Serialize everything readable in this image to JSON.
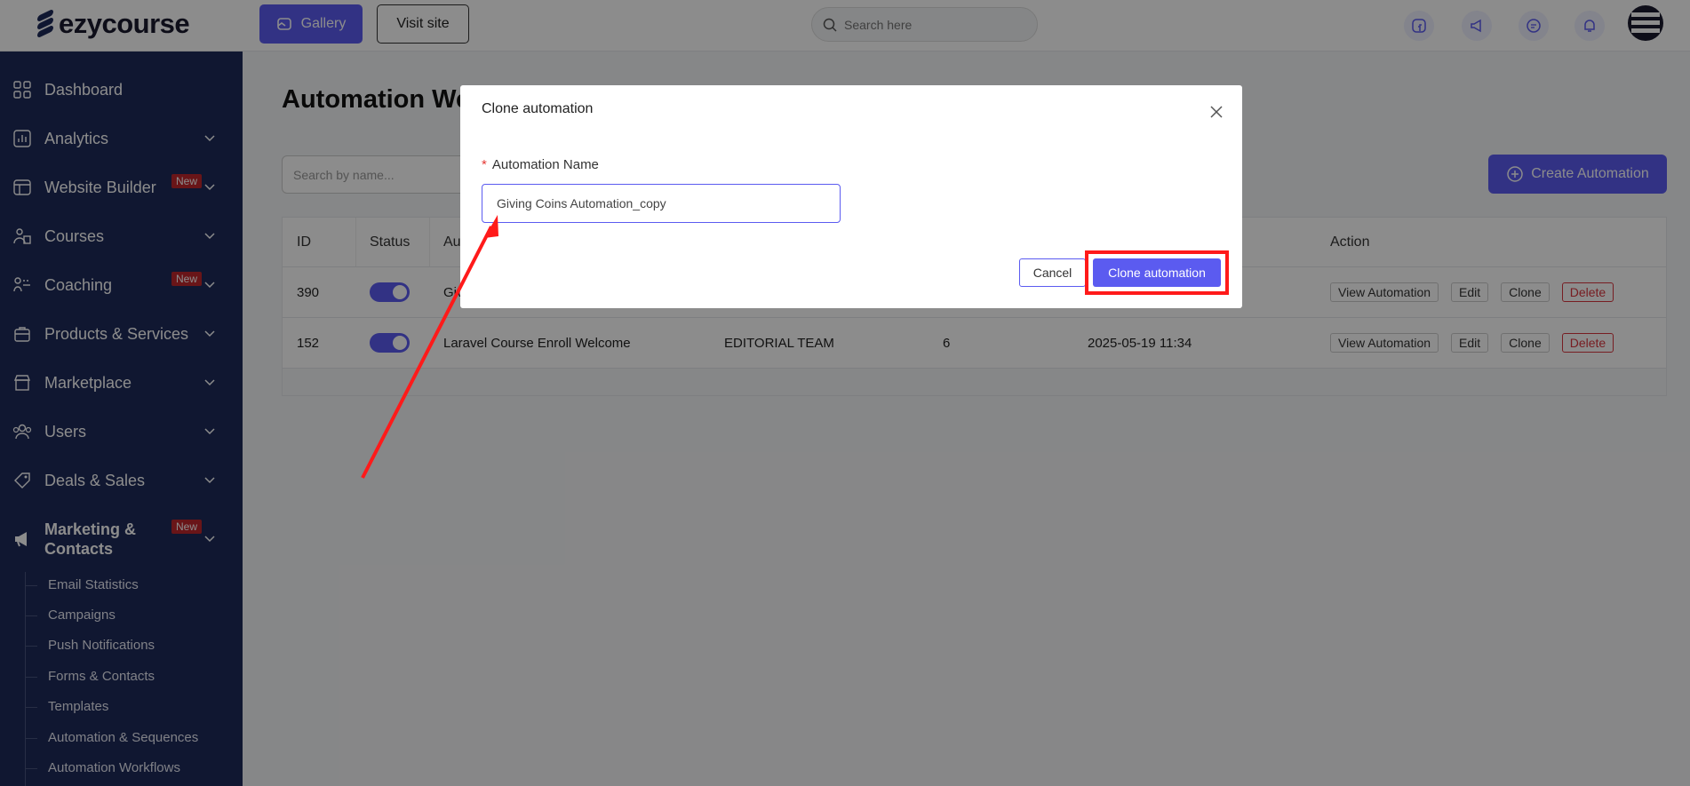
{
  "app": {
    "brand": "ezycourse"
  },
  "topbar": {
    "gallery_label": "Gallery",
    "visit_label": "Visit site",
    "search_placeholder": "Search here"
  },
  "sidebar": {
    "items": [
      {
        "label": "Dashboard",
        "icon": "dashboard-icon"
      },
      {
        "label": "Analytics",
        "icon": "analytics-icon"
      },
      {
        "label": "Website Builder",
        "icon": "website-icon",
        "badge": "New"
      },
      {
        "label": "Courses",
        "icon": "courses-icon"
      },
      {
        "label": "Coaching",
        "icon": "coaching-icon",
        "badge": "New"
      },
      {
        "label": "Products & Services",
        "icon": "products-icon"
      },
      {
        "label": "Marketplace",
        "icon": "marketplace-icon"
      },
      {
        "label": "Users",
        "icon": "users-icon"
      },
      {
        "label": "Deals & Sales",
        "icon": "deals-icon"
      },
      {
        "label_line1": "Marketing &",
        "label_line2": "Contacts",
        "icon": "megaphone-icon",
        "badge": "New"
      }
    ],
    "sub_items": [
      "Email Statistics",
      "Campaigns",
      "Push Notifications",
      "Forms & Contacts",
      "Templates",
      "Automation & Sequences",
      "Automation Workflows"
    ]
  },
  "main": {
    "title": "Automation We",
    "search_placeholder": "Search by name...",
    "create_label": "Create Automation",
    "table": {
      "headers": [
        "ID",
        "Status",
        "Au",
        "Action"
      ],
      "rows": [
        {
          "id": "390",
          "name": "Giv",
          "author": "",
          "count": "",
          "date": "",
          "actions": [
            "View Automation",
            "Edit",
            "Clone",
            "Delete"
          ]
        },
        {
          "id": "152",
          "name": "Laravel Course Enroll Welcome",
          "author": "EDITORIAL TEAM",
          "count": "6",
          "date": "2025-05-19 11:34",
          "actions": [
            "View Automation",
            "Edit",
            "Clone",
            "Delete"
          ]
        }
      ]
    }
  },
  "modal": {
    "title": "Clone automation",
    "field_label": "Automation Name",
    "required_mark": "*",
    "field_value": "Giving Coins Automation_copy",
    "cancel_label": "Cancel",
    "confirm_label": "Clone automation"
  },
  "colors": {
    "accent": "#5b5bf0",
    "sidebar": "#1e2a5a",
    "danger": "#d9363e",
    "annotation": "#ff1a1a"
  }
}
